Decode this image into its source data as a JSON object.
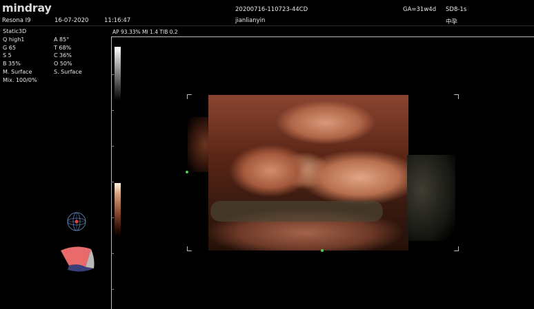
{
  "header": {
    "brand": "mindray",
    "system": "Resona I9",
    "date": "16-07-2020",
    "time": "11:16:47",
    "exam_id": "20200716-110723-44CD",
    "operator": "jianlianyin",
    "gestational_age": "GA=31w4d",
    "probe": "SD8-1s",
    "preset": "中孕",
    "mode": "Static3D"
  },
  "status_line": "AP 93.33%  MI 1.4 TIB 0.2",
  "params": {
    "q": "Q high1",
    "a": "A 85°",
    "g": "G 65",
    "t": "T 68%",
    "s": "S 5",
    "c": "C 36%",
    "b": "B 35%",
    "o": "O 50%",
    "m_surface": "M. Surface",
    "s_surface": "S. Surface",
    "mix": "Mix. 100/0%"
  },
  "icons": {
    "orientation": "orientation-globe-icon",
    "sector": "render-sector-icon"
  },
  "colors": {
    "background": "#000000",
    "text": "#e8e8e8",
    "marker": "#4fd04f",
    "skin": "#c07a58"
  }
}
